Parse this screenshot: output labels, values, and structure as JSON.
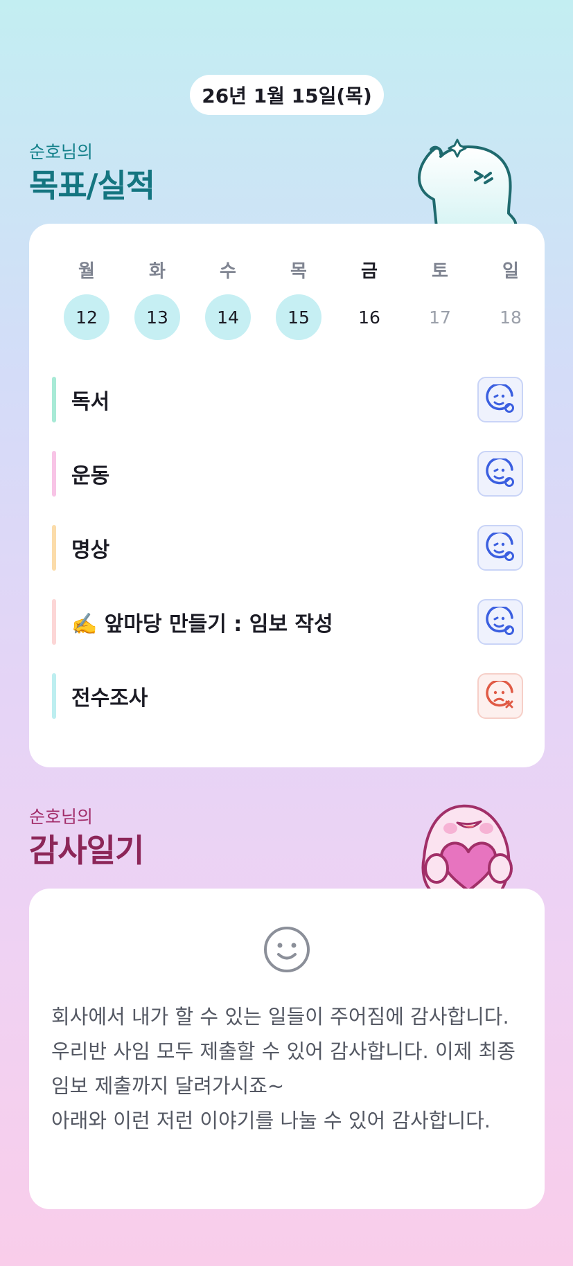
{
  "date": "26년 1월 15일(목)",
  "goals_section": {
    "subtitle": "순호님의",
    "title": "목표/실적",
    "week": [
      {
        "day": "월",
        "num": "12",
        "state": "done"
      },
      {
        "day": "화",
        "num": "13",
        "state": "done"
      },
      {
        "day": "수",
        "num": "14",
        "state": "done"
      },
      {
        "day": "목",
        "num": "15",
        "state": "done"
      },
      {
        "day": "금",
        "num": "16",
        "state": "today"
      },
      {
        "day": "토",
        "num": "17",
        "state": "future"
      },
      {
        "day": "일",
        "num": "18",
        "state": "future"
      }
    ],
    "goals": [
      {
        "label": "독서",
        "bar_color": "#a8ead6",
        "status": "ok"
      },
      {
        "label": "운동",
        "bar_color": "#f8c4e6",
        "status": "ok"
      },
      {
        "label": "명상",
        "bar_color": "#fbdcaa",
        "status": "ok"
      },
      {
        "label": "✍️ 앞마당 만들기 : 임보 작성",
        "bar_color": "#fcd6d6",
        "status": "ok"
      },
      {
        "label": "전수조사",
        "bar_color": "#bdeef0",
        "status": "fail"
      }
    ],
    "status_icons": {
      "ok": "smile-circle-icon",
      "fail": "frown-x-icon"
    },
    "colors": {
      "ok": "#3b5fe0",
      "fail": "#e05a45"
    }
  },
  "diary_section": {
    "subtitle": "순호님의",
    "title": "감사일기",
    "lines": [
      "회사에서 내가 할 수 있는 일들이 주어짐에 감사합니다.",
      "우리반 사임 모두 제출할 수 있어 감사합니다. 이제 최종임보 제출까지 달려가시죠~",
      "아래와 이런 저런 이야기를 나눌 수 있어 감사합니다."
    ],
    "icon": "smile-icon"
  }
}
